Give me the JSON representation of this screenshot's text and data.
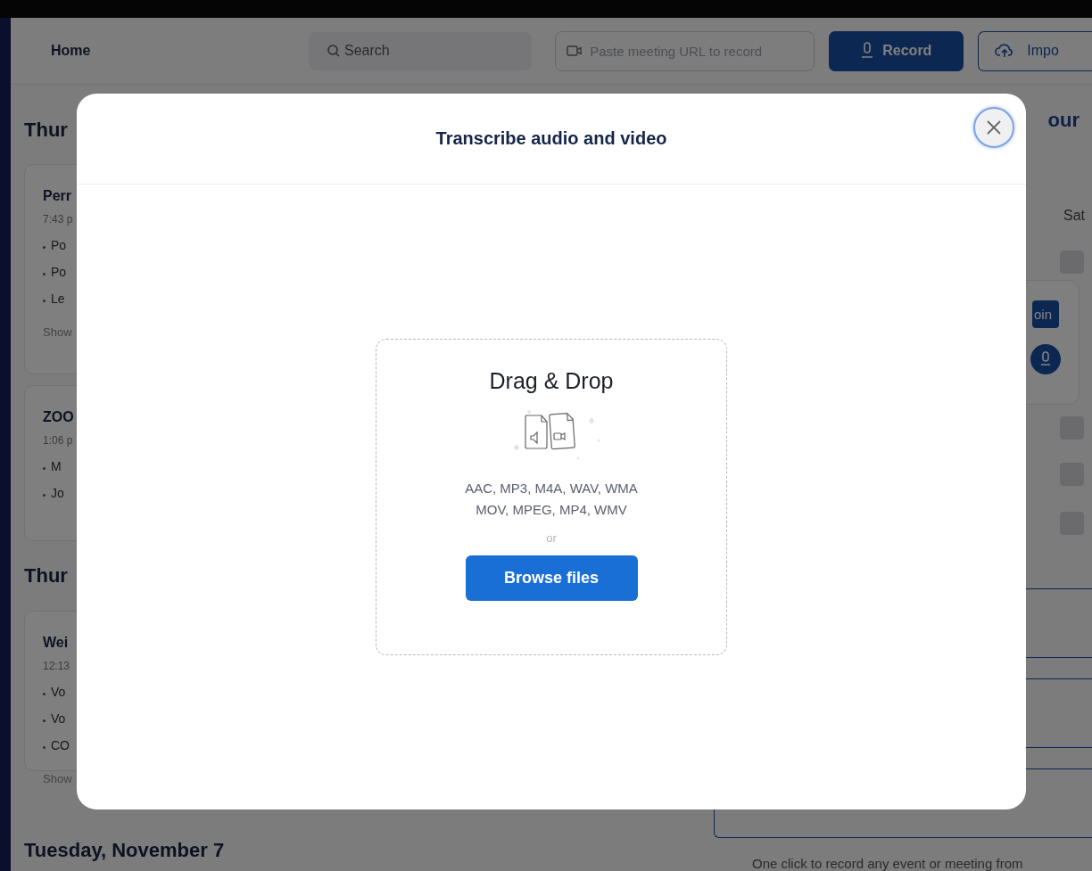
{
  "topbar": {
    "home": "Home",
    "search": {
      "placeholder": "Search"
    },
    "url_field": {
      "placeholder": "Paste meeting URL to record"
    },
    "record_button": "Record",
    "import_button": "Impo"
  },
  "feed": [
    {
      "heading": "Thur",
      "cards": [
        {
          "title": "Perr",
          "time": "7:43 p",
          "bullets": [
            "Po",
            "Po",
            "Le"
          ],
          "more": "Show"
        },
        {
          "title": "ZOO",
          "time": "1:06 p",
          "bullets": [
            "M",
            "Jo"
          ]
        }
      ]
    },
    {
      "heading": "Thur",
      "cards": [
        {
          "title": "Wei",
          "time": "12:13",
          "bullets": [
            "Vo",
            "Vo",
            "CO"
          ],
          "more": "Show"
        }
      ]
    },
    {
      "heading": "Tuesday, November 7"
    }
  ],
  "calendar": {
    "title": "our",
    "day": "Sat",
    "join_button": "oin"
  },
  "promo_text": "One click to record any event or meeting from",
  "dialog": {
    "title": "Transcribe audio and video",
    "drop_title": "Drag & Drop",
    "formats": [
      "AAC, MP3, M4A, WAV, WMA",
      "MOV, MPEG, MP4, WMV"
    ],
    "or": "or",
    "browse_button": "Browse files"
  }
}
